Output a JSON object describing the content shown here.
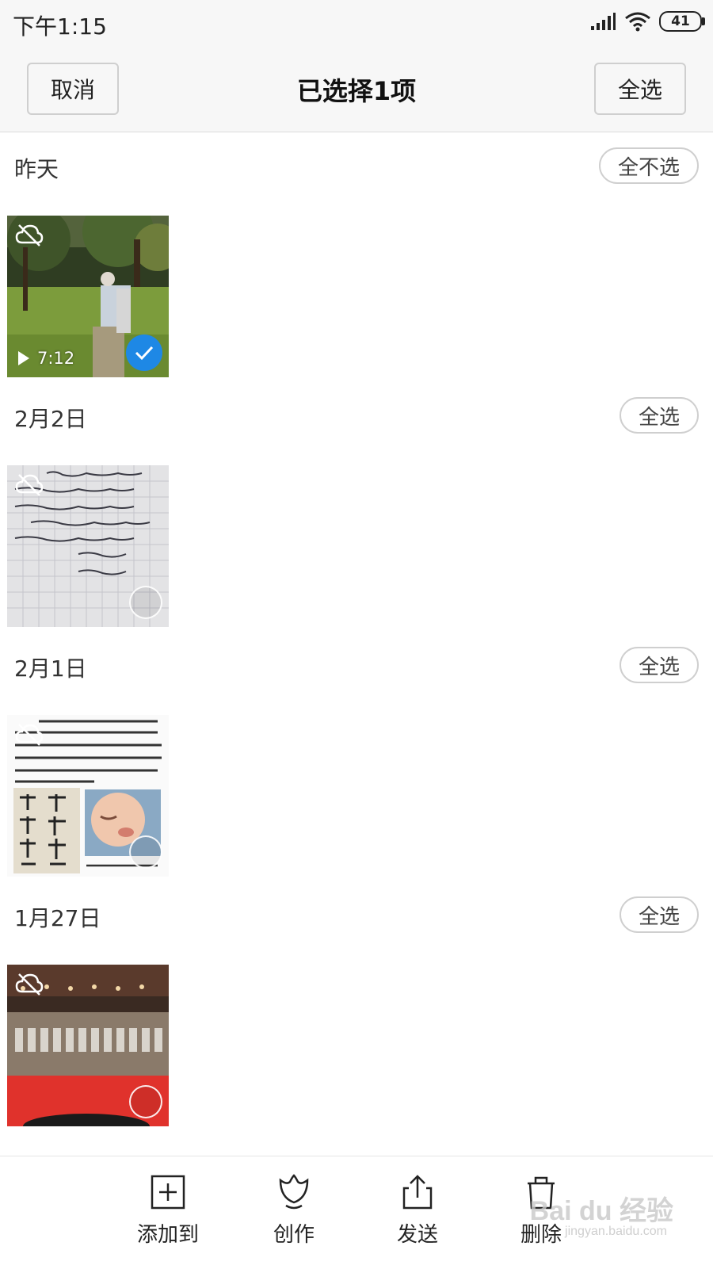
{
  "status_bar": {
    "time": "下午1:15",
    "battery": "41"
  },
  "header": {
    "cancel_label": "取消",
    "title": "已选择1项",
    "select_all_label": "全选"
  },
  "sections": [
    {
      "date": "昨天",
      "action_label": "全不选",
      "item": {
        "type": "video",
        "duration": "7:12",
        "selected": true
      }
    },
    {
      "date": "2月2日",
      "action_label": "全选",
      "item": {
        "type": "photo",
        "selected": false
      }
    },
    {
      "date": "2月1日",
      "action_label": "全选",
      "item": {
        "type": "photo",
        "selected": false
      }
    },
    {
      "date": "1月27日",
      "action_label": "全选",
      "item": {
        "type": "photo",
        "selected": false
      }
    }
  ],
  "actions": [
    {
      "label": "添加到",
      "icon": "add-to-album-icon"
    },
    {
      "label": "创作",
      "icon": "tulip-create-icon"
    },
    {
      "label": "发送",
      "icon": "share-icon"
    },
    {
      "label": "删除",
      "icon": "trash-icon"
    }
  ],
  "watermark": {
    "logo": "Bai du 经验",
    "url": "jingyan.baidu.com"
  },
  "colors": {
    "accent": "#1e88e5",
    "bar_bg": "#f7f7f7"
  }
}
